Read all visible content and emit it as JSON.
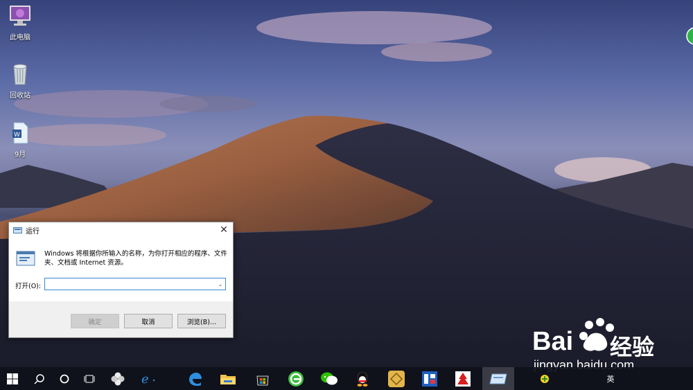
{
  "desktop": {
    "icons": [
      {
        "label": "此电脑",
        "icon": "computer-icon"
      },
      {
        "label": "回收站",
        "icon": "recycle-bin-icon"
      },
      {
        "label": "9月",
        "icon": "word-document-icon"
      }
    ]
  },
  "run_dialog": {
    "title": "运行",
    "description": "Windows 将根据你所输入的名称，为你打开相应的程序、文件夹、文档或 Internet 资源。",
    "open_label": "打开(O):",
    "open_value": "",
    "ok_label": "确定",
    "cancel_label": "取消",
    "browse_label": "浏览(B)..."
  },
  "taskbar": {
    "items": [
      {
        "name": "start-icon"
      },
      {
        "name": "search-icon"
      },
      {
        "name": "cortana-icon"
      },
      {
        "name": "task-view-icon"
      },
      {
        "name": "pinwheel-app-icon"
      },
      {
        "name": "internet-explorer-icon"
      },
      {
        "name": "edge-icon"
      },
      {
        "name": "file-explorer-icon"
      },
      {
        "name": "store-icon"
      },
      {
        "name": "browser-360-icon"
      },
      {
        "name": "wechat-icon"
      },
      {
        "name": "qq-icon"
      },
      {
        "name": "app-gold-icon"
      },
      {
        "name": "app-blue-icon"
      },
      {
        "name": "app-red-icon"
      },
      {
        "name": "run-dialog-task-icon"
      }
    ],
    "tray_text": "英"
  },
  "watermark": {
    "brand_left": "Bai",
    "brand_right": "经验",
    "url": "jingyan.baidu.com"
  },
  "colors": {
    "accent": "#3b86d6",
    "taskbar": "#0e101a"
  }
}
